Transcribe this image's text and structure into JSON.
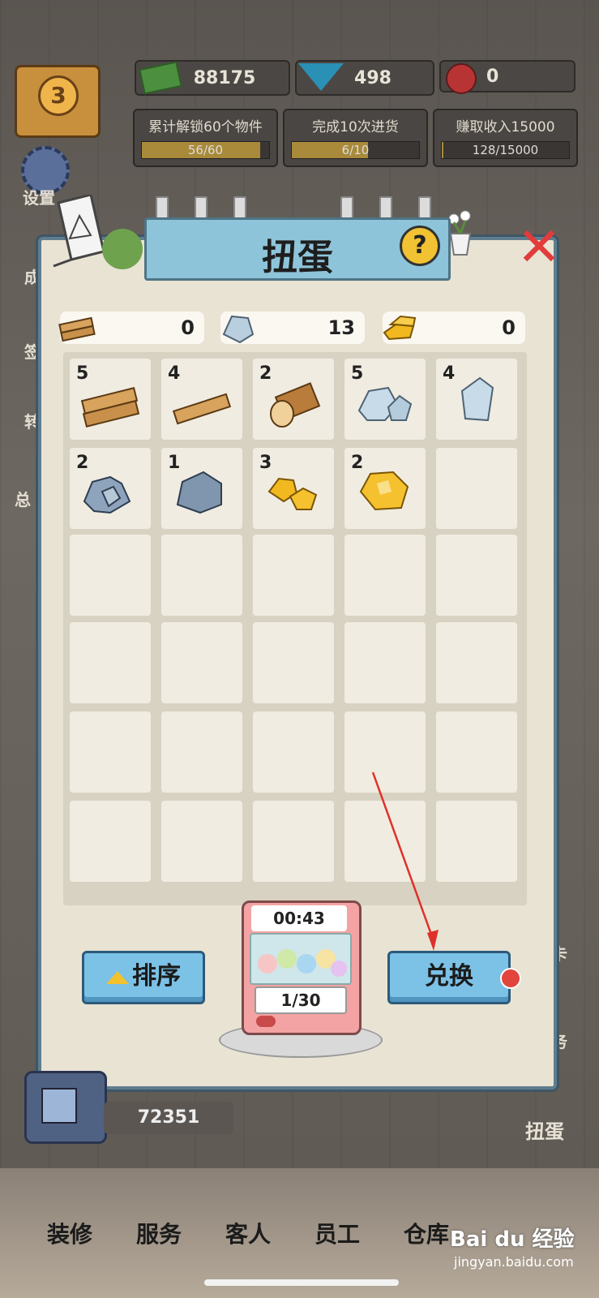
{
  "topbar": {
    "level": "3",
    "money": "88175",
    "gems": "498",
    "roses": "0"
  },
  "tasks": [
    {
      "title": "累计解锁60个物件",
      "progress": "56/60",
      "ratio": 0.93
    },
    {
      "title": "完成10次进货",
      "progress": "6/10",
      "ratio": 0.6
    },
    {
      "title": "赚取收入15000",
      "progress": "128/15000",
      "ratio": 0.01
    }
  ],
  "side": {
    "settings": "设置",
    "left_chars": [
      "成",
      "签",
      "转",
      "总"
    ]
  },
  "modal": {
    "title": "扭蛋",
    "help": "?",
    "resources": [
      {
        "icon": "wood-plank-icon",
        "value": "0"
      },
      {
        "icon": "silver-ore-icon",
        "value": "13"
      },
      {
        "icon": "gold-bar-icon",
        "value": "0"
      }
    ],
    "items": [
      {
        "icon": "wood-planks-icon",
        "count": "5"
      },
      {
        "icon": "wood-plank-icon",
        "count": "4"
      },
      {
        "icon": "log-icon",
        "count": "2"
      },
      {
        "icon": "silver-rocks-icon",
        "count": "5"
      },
      {
        "icon": "silver-crystal-icon",
        "count": "4"
      },
      {
        "icon": "stone-pile-icon",
        "count": "2"
      },
      {
        "icon": "stone-icon",
        "count": "1"
      },
      {
        "icon": "gold-nuggets-icon",
        "count": "3"
      },
      {
        "icon": "gold-nugget-icon",
        "count": "2"
      }
    ],
    "sort_label": "排序",
    "exchange_label": "兑换",
    "machine_timer": "00:43",
    "machine_count": "1/30"
  },
  "bottom": {
    "money": "72351",
    "right_label": "扭蛋",
    "right_top": "卡",
    "right_mid": "务",
    "nav": [
      "装修",
      "服务",
      "客人",
      "员工",
      "仓库"
    ],
    "watermark": "Bai du 经验",
    "watermark_url": "jingyan.baidu.com"
  },
  "colors": {
    "accent_blue": "#7cc1e6",
    "alert_red": "#e2453d",
    "panel": "#e9e3d4"
  }
}
